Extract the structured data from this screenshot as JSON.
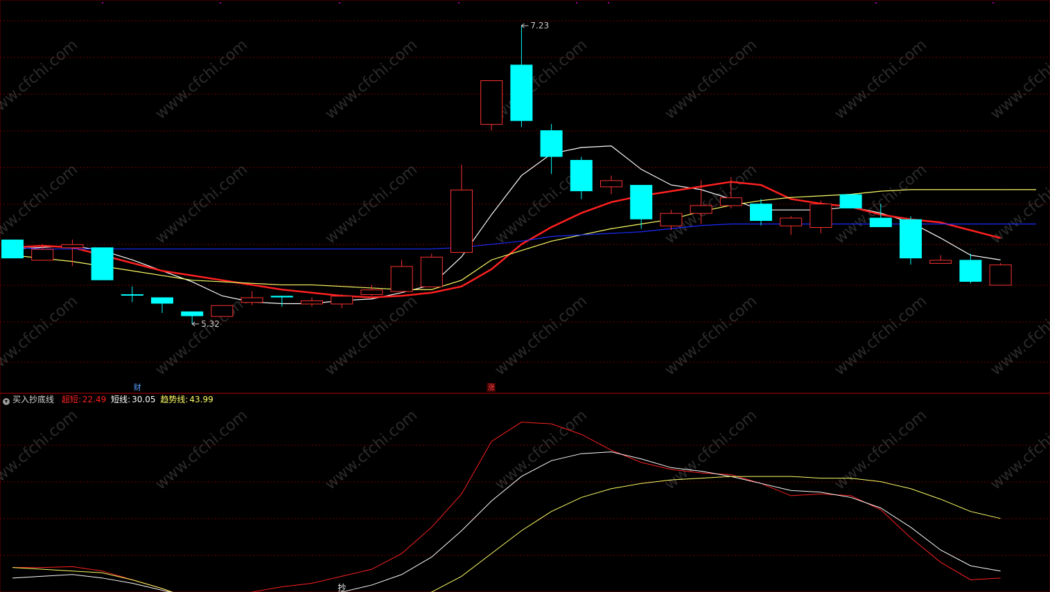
{
  "chart_data": [
    {
      "type": "candlestick",
      "panel": "price",
      "ylim": [
        5.0,
        7.35
      ],
      "annotations": {
        "high_label": "7.23",
        "low_label": "5.32"
      },
      "candles": [
        {
          "o": 5.86,
          "h": 5.86,
          "l": 5.76,
          "c": 5.74,
          "color": "cyan"
        },
        {
          "o": 5.73,
          "h": 5.83,
          "l": 5.73,
          "c": 5.8,
          "color": "red"
        },
        {
          "o": 5.81,
          "h": 5.86,
          "l": 5.69,
          "c": 5.83,
          "color": "red"
        },
        {
          "o": 5.81,
          "h": 5.81,
          "l": 5.6,
          "c": 5.6,
          "color": "cyan"
        },
        {
          "o": 5.51,
          "h": 5.56,
          "l": 5.46,
          "c": 5.51,
          "color": "cyan"
        },
        {
          "o": 5.49,
          "h": 5.49,
          "l": 5.39,
          "c": 5.45,
          "color": "cyan"
        },
        {
          "o": 5.4,
          "h": 5.4,
          "l": 5.32,
          "c": 5.37,
          "color": "cyan"
        },
        {
          "o": 5.37,
          "h": 5.44,
          "l": 5.37,
          "c": 5.44,
          "color": "red"
        },
        {
          "o": 5.46,
          "h": 5.53,
          "l": 5.44,
          "c": 5.49,
          "color": "red"
        },
        {
          "o": 5.5,
          "h": 5.5,
          "l": 5.43,
          "c": 5.49,
          "color": "cyan"
        },
        {
          "o": 5.45,
          "h": 5.49,
          "l": 5.43,
          "c": 5.47,
          "color": "red"
        },
        {
          "o": 5.45,
          "h": 5.51,
          "l": 5.42,
          "c": 5.5,
          "color": "red"
        },
        {
          "o": 5.51,
          "h": 5.57,
          "l": 5.5,
          "c": 5.54,
          "color": "red"
        },
        {
          "o": 5.53,
          "h": 5.73,
          "l": 5.52,
          "c": 5.69,
          "color": "red"
        },
        {
          "o": 5.56,
          "h": 5.77,
          "l": 5.56,
          "c": 5.75,
          "color": "red"
        },
        {
          "o": 5.78,
          "h": 6.34,
          "l": 5.78,
          "c": 6.18,
          "color": "red"
        },
        {
          "o": 6.6,
          "h": 6.88,
          "l": 6.56,
          "c": 6.88,
          "color": "red"
        },
        {
          "o": 6.98,
          "h": 7.23,
          "l": 6.58,
          "c": 6.62,
          "color": "cyan"
        },
        {
          "o": 6.56,
          "h": 6.6,
          "l": 6.28,
          "c": 6.39,
          "color": "cyan"
        },
        {
          "o": 6.37,
          "h": 6.39,
          "l": 6.12,
          "c": 6.17,
          "color": "cyan"
        },
        {
          "o": 6.2,
          "h": 6.27,
          "l": 6.15,
          "c": 6.24,
          "color": "red"
        },
        {
          "o": 6.21,
          "h": 6.21,
          "l": 5.93,
          "c": 5.99,
          "color": "cyan"
        },
        {
          "o": 5.95,
          "h": 6.05,
          "l": 5.92,
          "c": 6.03,
          "color": "red"
        },
        {
          "o": 6.03,
          "h": 6.24,
          "l": 5.96,
          "c": 6.08,
          "color": "red"
        },
        {
          "o": 6.08,
          "h": 6.26,
          "l": 6.06,
          "c": 6.13,
          "color": "red"
        },
        {
          "o": 6.09,
          "h": 6.12,
          "l": 5.95,
          "c": 5.98,
          "color": "cyan"
        },
        {
          "o": 5.95,
          "h": 6.01,
          "l": 5.89,
          "c": 6.0,
          "color": "red"
        },
        {
          "o": 5.94,
          "h": 6.11,
          "l": 5.9,
          "c": 6.09,
          "color": "red"
        },
        {
          "o": 6.15,
          "h": 6.15,
          "l": 6.06,
          "c": 6.06,
          "color": "cyan"
        },
        {
          "o": 6.0,
          "h": 6.09,
          "l": 5.96,
          "c": 5.94,
          "color": "cyan"
        },
        {
          "o": 5.99,
          "h": 6.01,
          "l": 5.7,
          "c": 5.74,
          "color": "cyan"
        },
        {
          "o": 5.73,
          "h": 5.76,
          "l": 5.71,
          "c": 5.71,
          "color": "red"
        },
        {
          "o": 5.73,
          "h": 5.77,
          "l": 5.58,
          "c": 5.59,
          "color": "cyan"
        },
        {
          "o": 5.57,
          "h": 5.71,
          "l": 5.57,
          "c": 5.7,
          "color": "red"
        }
      ],
      "series": [
        {
          "color": "#ffffff",
          "values": [
            5.8,
            5.81,
            5.82,
            5.79,
            5.73,
            5.66,
            5.59,
            5.5,
            5.46,
            5.45,
            5.45,
            5.47,
            5.48,
            5.52,
            5.57,
            5.75,
            6.02,
            6.27,
            6.41,
            6.45,
            6.46,
            6.31,
            6.21,
            6.18,
            6.12,
            6.05,
            6.05,
            6.05,
            6.07,
            6.03,
            5.97,
            5.87,
            5.76,
            5.73
          ]
        },
        {
          "color": "#ff2020",
          "values": [
            5.81,
            5.82,
            5.81,
            5.76,
            5.71,
            5.66,
            5.63,
            5.6,
            5.57,
            5.54,
            5.52,
            5.5,
            5.49,
            5.5,
            5.52,
            5.56,
            5.67,
            5.83,
            5.94,
            6.03,
            6.1,
            6.14,
            6.17,
            6.2,
            6.23,
            6.21,
            6.12,
            6.09,
            6.07,
            6.02,
            5.99,
            5.97,
            5.92,
            5.87
          ]
        },
        {
          "color": "#ffff66",
          "values": [
            5.76,
            5.74,
            5.72,
            5.69,
            5.66,
            5.63,
            5.6,
            5.59,
            5.58,
            5.57,
            5.57,
            5.56,
            5.55,
            5.54,
            5.54,
            5.6,
            5.73,
            5.79,
            5.85,
            5.89,
            5.93,
            5.96,
            5.99,
            6.04,
            6.08,
            6.11,
            6.13,
            6.14,
            6.15,
            6.17,
            6.18,
            6.18,
            6.18,
            6.18
          ]
        },
        {
          "color": "#1a2cff",
          "values": [
            5.81,
            5.8,
            5.8,
            5.8,
            5.8,
            5.8,
            5.8,
            5.8,
            5.8,
            5.8,
            5.8,
            5.8,
            5.8,
            5.8,
            5.8,
            5.81,
            5.83,
            5.85,
            5.88,
            5.89,
            5.9,
            5.91,
            5.93,
            5.95,
            5.96,
            5.96,
            5.96,
            5.96,
            5.96,
            5.96,
            5.96,
            5.96,
            5.96,
            5.96
          ]
        }
      ],
      "markers": [
        {
          "candle_index": 4,
          "label": "财",
          "color": "#5aa0ff"
        },
        {
          "candle_index": 16,
          "label": "涨",
          "color": "#ff4040"
        }
      ]
    },
    {
      "type": "line",
      "panel": "indicator",
      "title": "买入抄底线",
      "ylim": [
        0,
        100
      ],
      "series": [
        {
          "name": "超短",
          "value": "22.49",
          "color": "#ff2020",
          "values": [
            12,
            12,
            12.5,
            10,
            5,
            0,
            -6,
            -8,
            -2,
            1,
            3,
            7,
            11,
            20,
            35,
            54,
            84,
            95,
            94,
            88,
            79,
            72,
            68,
            66,
            65,
            60,
            53,
            54,
            53,
            45,
            29,
            15,
            5,
            6
          ]
        },
        {
          "name": "短线",
          "value": "30.05",
          "color": "#ffffff",
          "values": [
            6,
            7,
            8,
            6,
            3,
            -1,
            -5,
            -7,
            -6,
            -5,
            -4,
            -2,
            2,
            8,
            18,
            33,
            50,
            64,
            73,
            77,
            78,
            74,
            69,
            67,
            64,
            60,
            56,
            55,
            52,
            46,
            35,
            22,
            13,
            10
          ]
        },
        {
          "name": "趋势线",
          "value": "43.99",
          "color": "#ffff66",
          "values": [
            12,
            11,
            10,
            9,
            5,
            0,
            -6,
            -8,
            -8,
            -8,
            -8,
            -8,
            -8,
            -6,
            -2,
            7,
            20,
            33,
            44,
            52,
            57,
            60,
            62,
            63,
            64,
            64,
            64,
            63,
            63,
            61,
            57,
            51,
            44,
            40
          ]
        }
      ],
      "markers": [
        {
          "candle_index": 11,
          "label": "抄",
          "color": "#ffffff"
        }
      ]
    }
  ],
  "watermark": "www.cfchi.com",
  "colors": {
    "background": "#000000",
    "grid": "#7a0000",
    "separator": "#b40000",
    "candle_up": "#ff3232",
    "candle_down": "#00ffff",
    "annotation": "#c8c8c8"
  },
  "indicator_legend": {
    "title": "买入抄底线",
    "items": [
      {
        "label": "超短:",
        "value": "22.49",
        "color": "#ff2020"
      },
      {
        "label": "短线:",
        "value": "30.05",
        "color": "#ffffff"
      },
      {
        "label": "趋势线:",
        "value": "43.99",
        "color": "#ffff66"
      }
    ]
  }
}
